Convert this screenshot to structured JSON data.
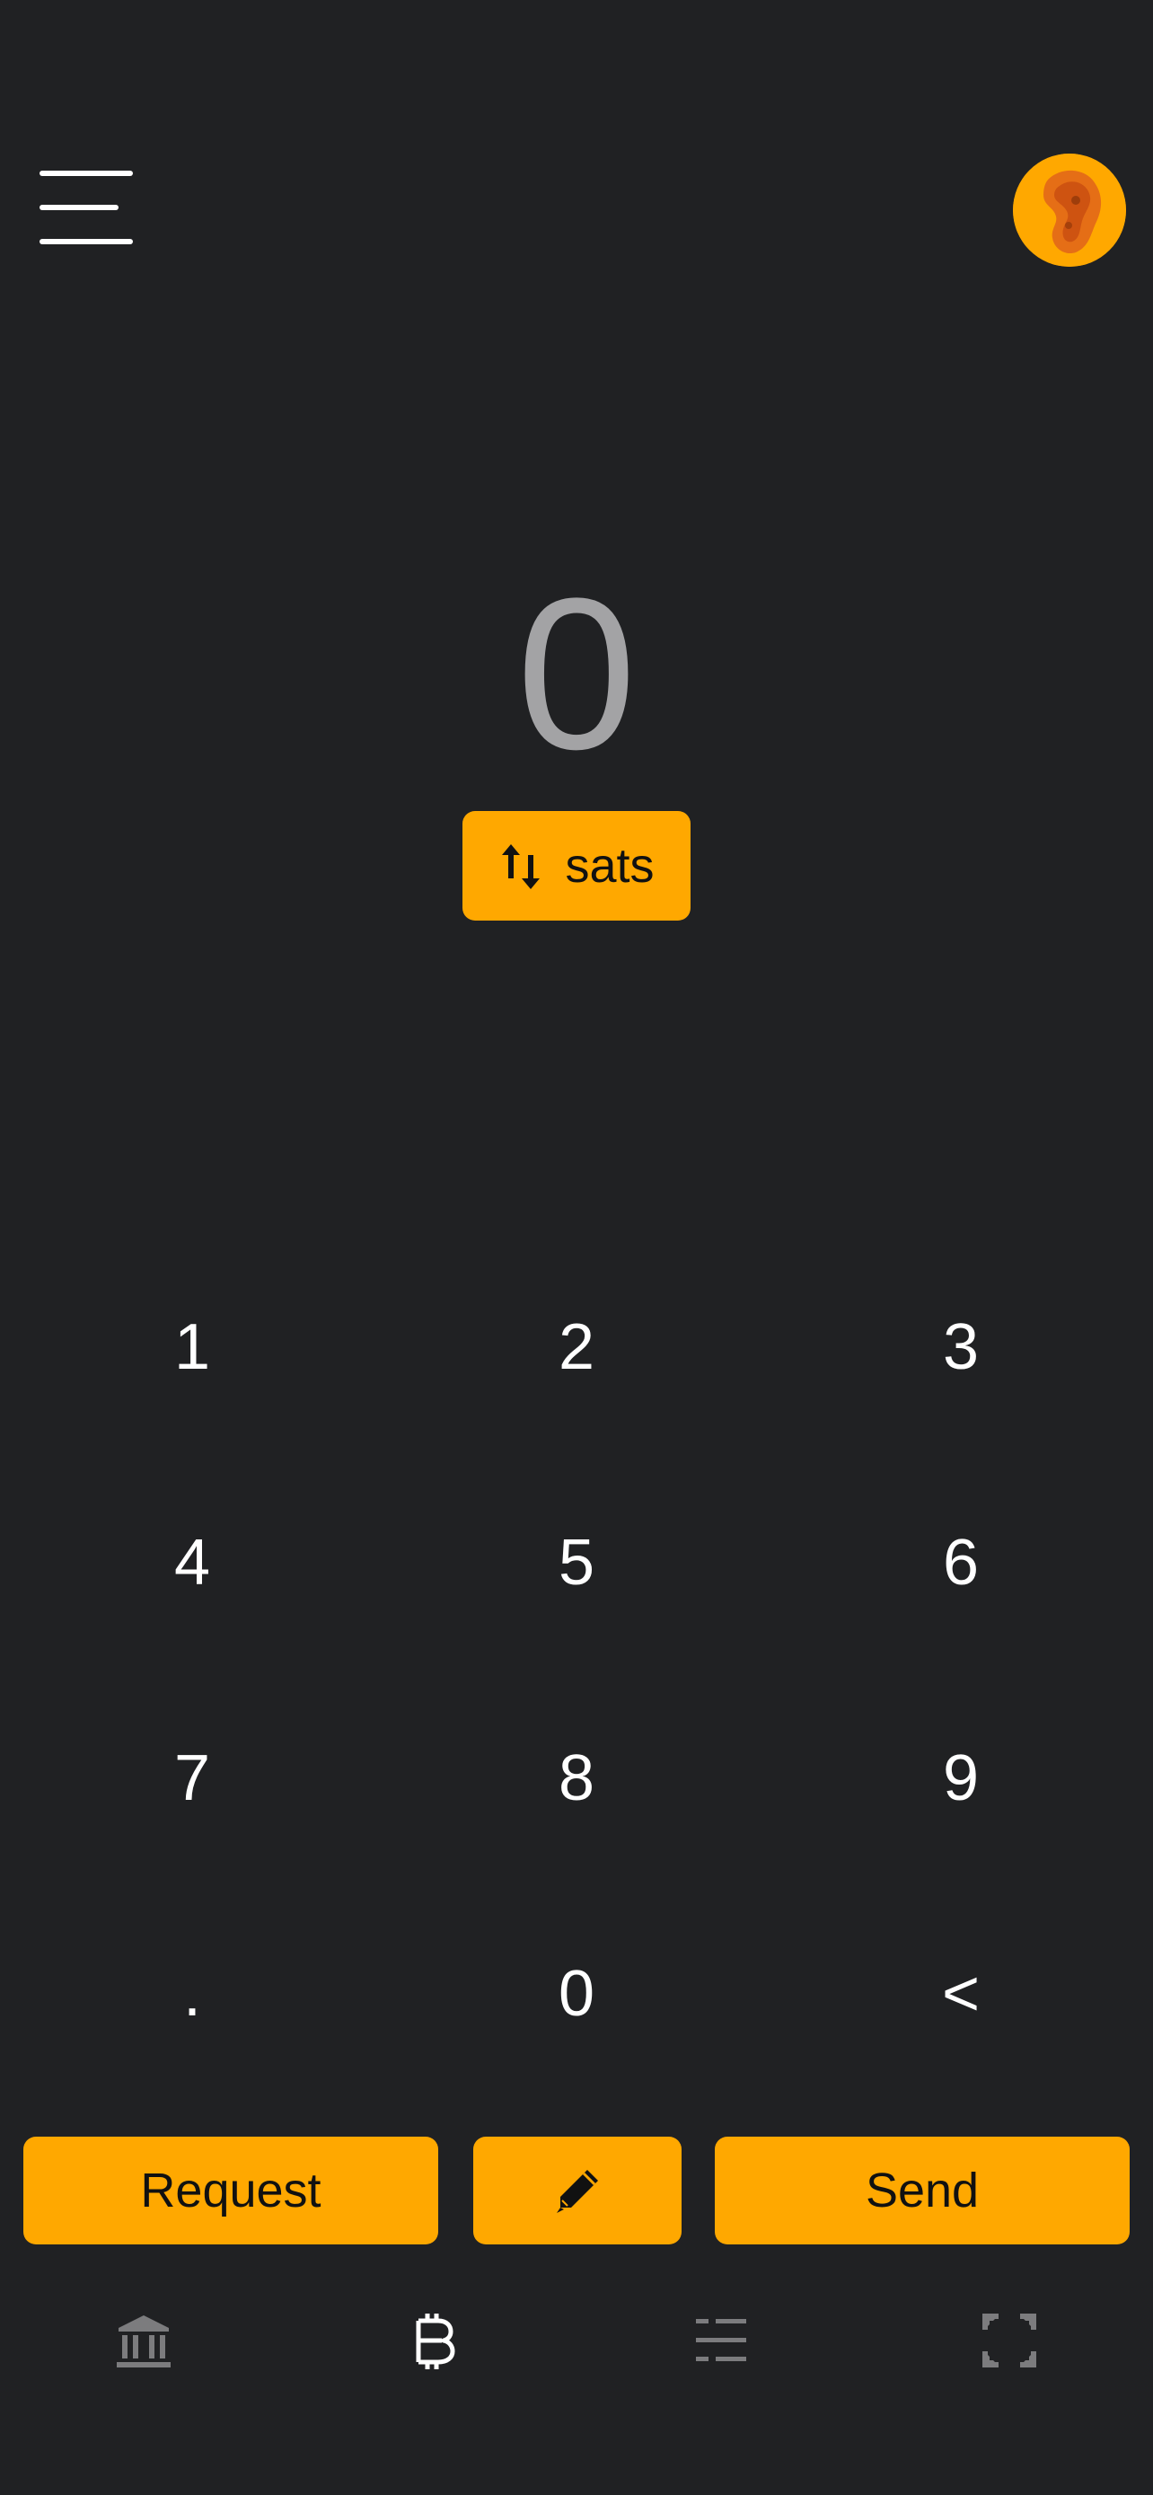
{
  "header": {
    "menu_icon": "hamburger-menu-icon",
    "avatar_icon": "profile-avatar"
  },
  "amount": {
    "value": "0"
  },
  "unit_toggle": {
    "icon": "swap-vertical-icon",
    "label": "sats"
  },
  "keypad": {
    "keys": [
      "1",
      "2",
      "3",
      "4",
      "5",
      "6",
      "7",
      "8",
      "9",
      ".",
      "0",
      "<"
    ]
  },
  "actions": {
    "request_label": "Request",
    "edit_icon": "pencil-icon",
    "send_label": "Send"
  },
  "bottom_nav": {
    "items": [
      {
        "icon": "bank-icon",
        "active": false
      },
      {
        "icon": "bitcoin-icon",
        "active": true
      },
      {
        "icon": "list-icon",
        "active": false
      },
      {
        "icon": "scan-icon",
        "active": false
      }
    ]
  },
  "colors": {
    "background": "#202123",
    "accent": "#ffa800",
    "amount_text": "#a3a3a5",
    "nav_inactive": "#7c7c7e",
    "nav_active": "#ffffff"
  }
}
